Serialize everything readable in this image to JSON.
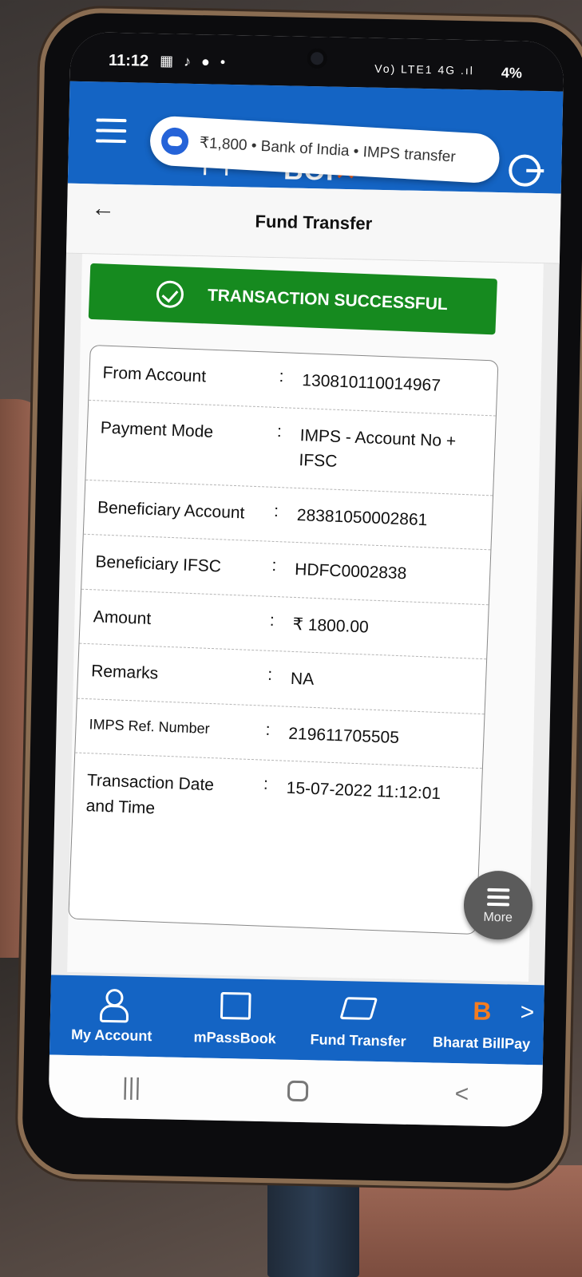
{
  "status_bar": {
    "time": "11:12",
    "left_icons": "▦ ♪ ●  •",
    "signal": "Vo) LTE1 4G .ıl",
    "battery": "4%"
  },
  "notification": {
    "text": "₹1,800 • Bank of India • IMPS transfer"
  },
  "header": {
    "logo_text": "BOI",
    "logo_mark": "✕"
  },
  "page": {
    "title": "Fund Transfer",
    "back_glyph": "←"
  },
  "banner": {
    "text": "TRANSACTION SUCCESSFUL",
    "color": "#168a1f"
  },
  "details": [
    {
      "label": "From Account",
      "sep": ":",
      "value": "130810110014967"
    },
    {
      "label": "Payment Mode",
      "sep": ":",
      "value": "IMPS - Account No + IFSC"
    },
    {
      "label": "Beneficiary Account",
      "sep": ":",
      "value": "28381050002861"
    },
    {
      "label": "Beneficiary IFSC",
      "sep": ":",
      "value": "HDFC0002838"
    },
    {
      "label": "Amount",
      "sep": ":",
      "value": "₹ 1800.00"
    },
    {
      "label": "Remarks",
      "sep": ":",
      "value": "NA"
    },
    {
      "label": "IMPS Ref. Number",
      "sep": ":",
      "value": "219611705505"
    },
    {
      "label": "Transaction Date and Time",
      "sep": ":",
      "value": "15-07-2022 11:12:01"
    }
  ],
  "fab": {
    "label": "More"
  },
  "bottom_nav": {
    "items": [
      {
        "label": "My Account",
        "icon": "user-icon"
      },
      {
        "label": "mPassBook",
        "icon": "passbook-icon"
      },
      {
        "label": "Fund Transfer",
        "icon": "transfer-icon"
      },
      {
        "label": "Bharat BillPay",
        "icon": "bbps-icon",
        "icon_text": "B"
      }
    ],
    "next_glyph": ">"
  },
  "system_nav": {
    "recents_glyph": "|||",
    "back_glyph": "<"
  },
  "colors": {
    "brand_blue": "#1464c4",
    "success_green": "#168a1f",
    "accent_orange": "#f05a1a"
  }
}
